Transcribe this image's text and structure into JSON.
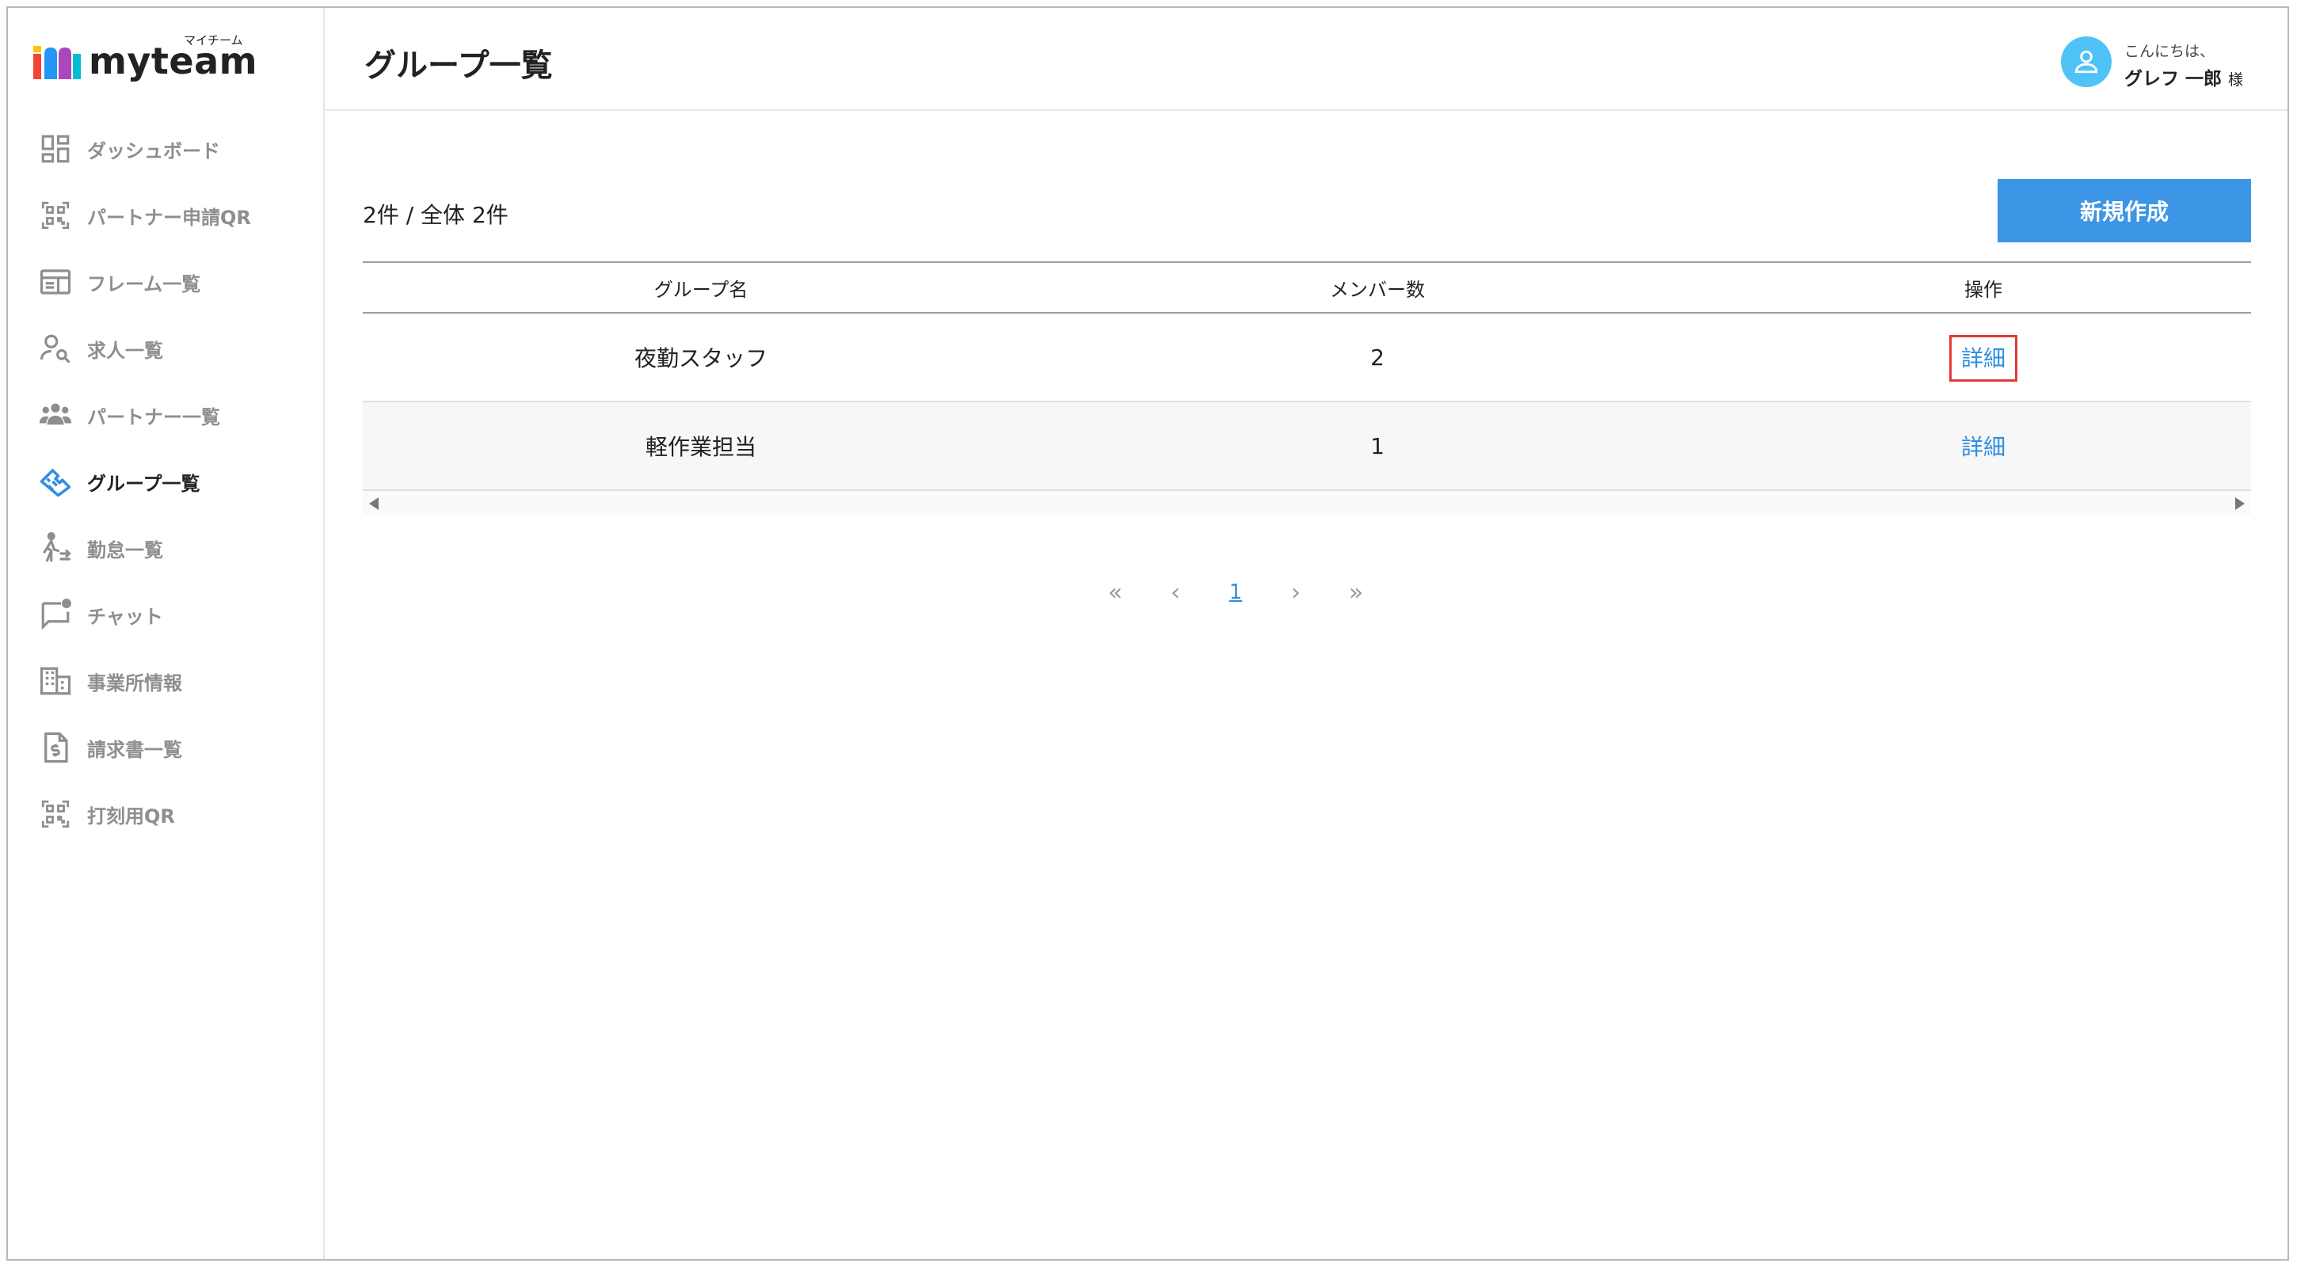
{
  "app": {
    "logo_text": "myteam",
    "logo_kana": "マイチーム",
    "accent_color": "#3d95e6"
  },
  "sidebar": {
    "items": [
      {
        "label": "ダッシュボード",
        "icon": "dashboard-icon"
      },
      {
        "label": "パートナー申請QR",
        "icon": "qr-code-icon"
      },
      {
        "label": "フレーム一覧",
        "icon": "frame-icon"
      },
      {
        "label": "求人一覧",
        "icon": "person-search-icon"
      },
      {
        "label": "パートナー一覧",
        "icon": "people-icon"
      },
      {
        "label": "グループ一覧",
        "icon": "handshake-icon",
        "active": true
      },
      {
        "label": "勤怠一覧",
        "icon": "walking-person-icon"
      },
      {
        "label": "チャット",
        "icon": "chat-icon"
      },
      {
        "label": "事業所情報",
        "icon": "building-icon"
      },
      {
        "label": "請求書一覧",
        "icon": "invoice-icon"
      },
      {
        "label": "打刻用QR",
        "icon": "qr-code-icon"
      }
    ]
  },
  "header": {
    "title": "グループ一覧",
    "greeting": "こんにちは、",
    "user_name": "グレフ 一郎",
    "honorific": "様"
  },
  "main": {
    "count_text": "2件 / 全体 2件",
    "new_button": "新規作成",
    "table": {
      "headers": [
        "グループ名",
        "メンバー数",
        "操作"
      ],
      "rows": [
        {
          "name": "夜勤スタッフ",
          "members": "2",
          "action": "詳細"
        },
        {
          "name": "軽作業担当",
          "members": "1",
          "action": "詳細"
        }
      ]
    },
    "pagination": {
      "first": "«",
      "prev": "‹",
      "current": "1",
      "next": "›",
      "last": "»"
    }
  }
}
